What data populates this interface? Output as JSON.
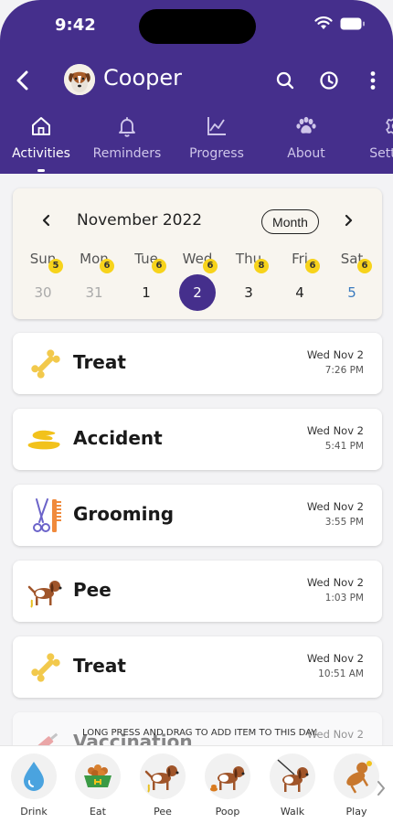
{
  "status": {
    "time": "9:42"
  },
  "header": {
    "pet_name": "Cooper",
    "tabs": [
      {
        "label": "Activities",
        "icon": "house-icon",
        "active": true
      },
      {
        "label": "Reminders",
        "icon": "bell-icon",
        "active": false
      },
      {
        "label": "Progress",
        "icon": "chart-icon",
        "active": false
      },
      {
        "label": "About",
        "icon": "paw-icon",
        "active": false
      },
      {
        "label": "Settings",
        "icon": "gear-icon",
        "active": false
      }
    ]
  },
  "calendar": {
    "month": "November 2022",
    "view_button": "Month",
    "days": [
      {
        "weekday": "Sun",
        "date": "30",
        "badge": "5",
        "state": "muted"
      },
      {
        "weekday": "Mon",
        "date": "31",
        "badge": "6",
        "state": "muted"
      },
      {
        "weekday": "Tue",
        "date": "1",
        "badge": "6",
        "state": "normal"
      },
      {
        "weekday": "Wed",
        "date": "2",
        "badge": "6",
        "state": "selected"
      },
      {
        "weekday": "Thu",
        "date": "3",
        "badge": "8",
        "state": "normal"
      },
      {
        "weekday": "Fri",
        "date": "4",
        "badge": "6",
        "state": "normal"
      },
      {
        "weekday": "Sat",
        "date": "5",
        "badge": "6",
        "state": "sat"
      }
    ]
  },
  "activities": [
    {
      "title": "Treat",
      "date": "Wed Nov 2",
      "time": "7:26 PM",
      "icon": "bone-icon"
    },
    {
      "title": "Accident",
      "date": "Wed Nov 2",
      "time": "5:41 PM",
      "icon": "puddle-icon"
    },
    {
      "title": "Grooming",
      "date": "Wed Nov 2",
      "time": "3:55 PM",
      "icon": "scissors-comb-icon"
    },
    {
      "title": "Pee",
      "date": "Wed Nov 2",
      "time": "1:03 PM",
      "icon": "dog-pee-icon"
    },
    {
      "title": "Treat",
      "date": "Wed Nov 2",
      "time": "10:51 AM",
      "icon": "bone-icon"
    },
    {
      "title": "Vaccination",
      "date": "Wed Nov 2",
      "time": "",
      "icon": "syringe-icon"
    }
  ],
  "hint": "LONG PRESS AND DRAG TO ADD ITEM TO THIS DAY.",
  "tray": {
    "items": [
      {
        "label": "Drink",
        "icon": "water-drop-icon"
      },
      {
        "label": "Eat",
        "icon": "food-bowl-icon"
      },
      {
        "label": "Pee",
        "icon": "dog-pee-icon"
      },
      {
        "label": "Poop",
        "icon": "dog-poop-icon"
      },
      {
        "label": "Walk",
        "icon": "dog-walk-icon"
      },
      {
        "label": "Play",
        "icon": "dog-play-icon"
      }
    ]
  },
  "colors": {
    "header": "#452f8c",
    "calendar_bg": "#f8f5ef",
    "badge": "#f7d31b",
    "selected_day": "#452f8c"
  }
}
